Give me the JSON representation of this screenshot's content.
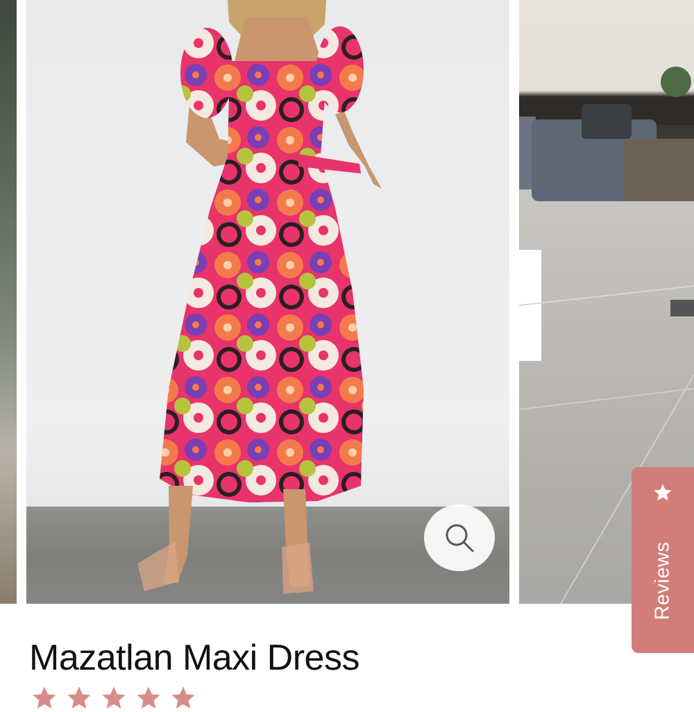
{
  "product": {
    "title": "Mazatlan Maxi Dress",
    "rating_stars": 5
  },
  "gallery": {
    "zoom_icon": "search-icon",
    "image_subject": "model wearing floral maxi dress"
  },
  "reviews_tab": {
    "label": "Reviews",
    "icon": "star-icon"
  },
  "colors": {
    "reviews_tab_bg": "#d37d7a",
    "star_color": "#d98d8a",
    "title_color": "#111111"
  }
}
